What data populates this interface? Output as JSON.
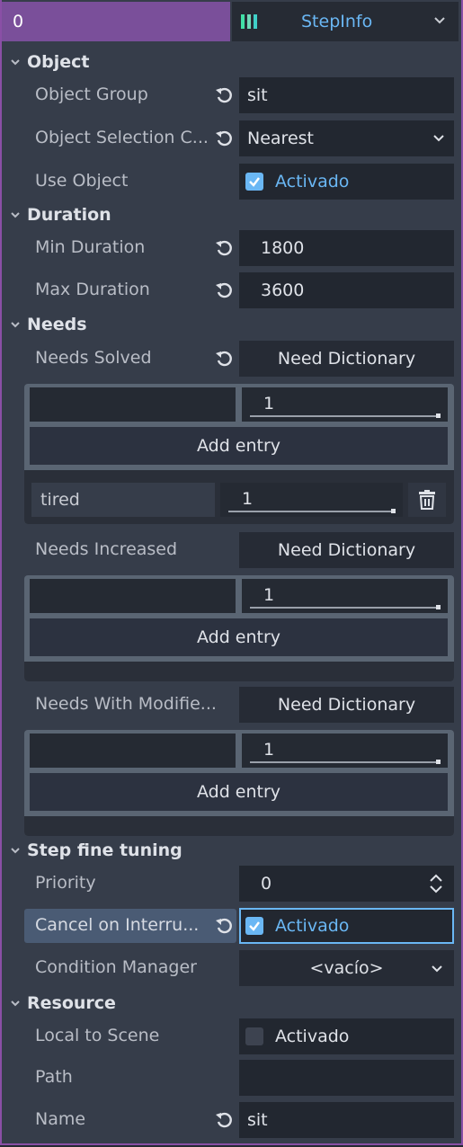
{
  "header": {
    "index": "0",
    "resource_name": "StepInfo"
  },
  "sections": {
    "object": "Object",
    "duration": "Duration",
    "needs": "Needs",
    "step_fine_tuning": "Step fine tuning",
    "resource": "Resource"
  },
  "object": {
    "group_label": "Object Group",
    "group_value": "sit",
    "selection_label": "Object Selection C...",
    "selection_value": "Nearest",
    "use_label": "Use Object",
    "use_value": "Activado",
    "use_checked": true
  },
  "duration": {
    "min_label": "Min Duration",
    "min_value": "1800",
    "max_label": "Max Duration",
    "max_value": "3600"
  },
  "needs": {
    "solved_label": "Needs Solved",
    "solved_button": "Need Dictionary",
    "solved_new_value": "1",
    "add_entry": "Add entry",
    "solved_entry_key": "tired",
    "solved_entry_value": "1",
    "increased_label": "Needs Increased",
    "increased_button": "Need Dictionary",
    "increased_new_value": "1",
    "modifiers_label": "Needs With Modifie...",
    "modifiers_button": "Need Dictionary",
    "modifiers_new_value": "1"
  },
  "tuning": {
    "priority_label": "Priority",
    "priority_value": "0",
    "cancel_label": "Cancel on Interru...",
    "cancel_value": "Activado",
    "cancel_checked": true,
    "condition_label": "Condition Manager",
    "condition_value": "<vacío>"
  },
  "resource": {
    "local_label": "Local to Scene",
    "local_value": "Activado",
    "local_checked": false,
    "path_label": "Path",
    "path_value": "",
    "name_label": "Name",
    "name_value": "sit"
  },
  "colors": {
    "accent": "#6ab7f4",
    "header": "#7a4f9a",
    "bg": "#363d4a"
  }
}
